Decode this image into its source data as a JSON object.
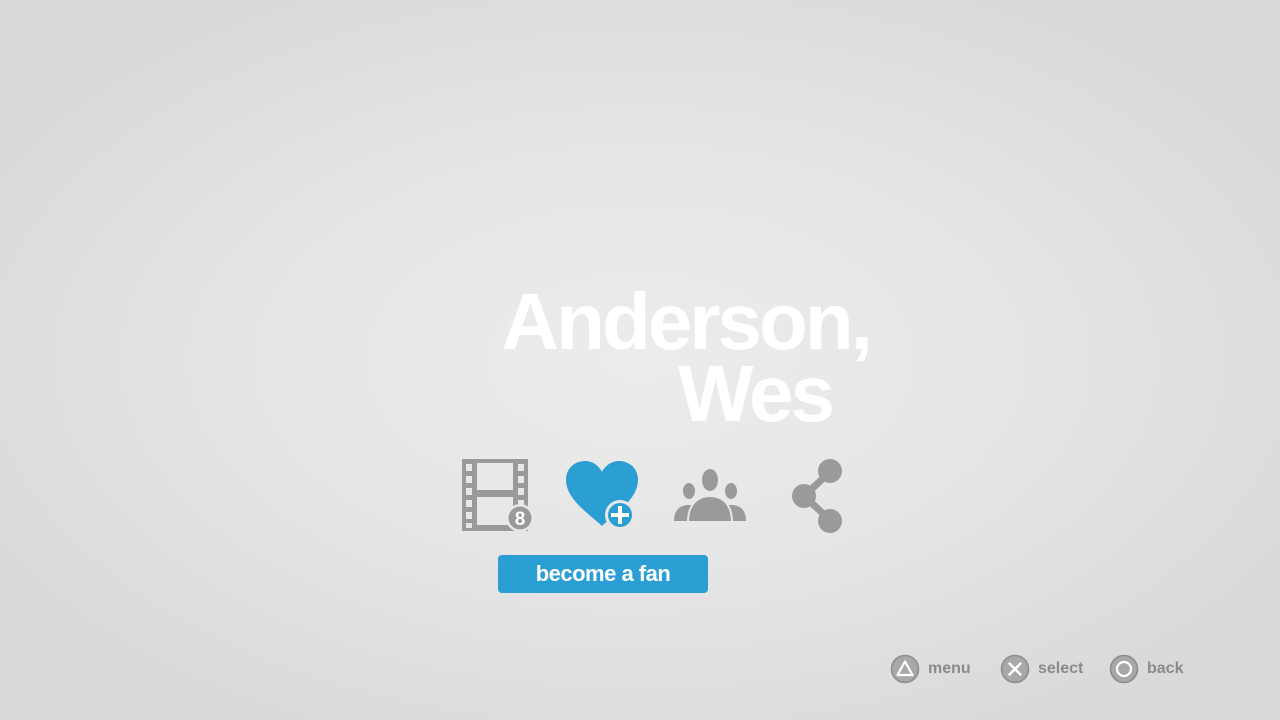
{
  "artist": {
    "name_line1": "Anderson,",
    "name_line2": "Wes"
  },
  "actions": {
    "filmography_badge": "8",
    "fan_button_label": "become a fan"
  },
  "icons": {
    "filmography": "film-strip-icon",
    "become_fan": "heart-plus-icon",
    "fans": "group-icon",
    "share": "share-icon"
  },
  "hints": {
    "menu": {
      "icon": "triangle-button-icon",
      "label": "menu"
    },
    "select": {
      "icon": "cross-button-icon",
      "label": "select"
    },
    "back": {
      "icon": "circle-button-icon",
      "label": "back"
    }
  },
  "colors": {
    "accent": "#2b9fd4",
    "icon_gray": "#9a9a9a",
    "title": "#ffffff"
  }
}
